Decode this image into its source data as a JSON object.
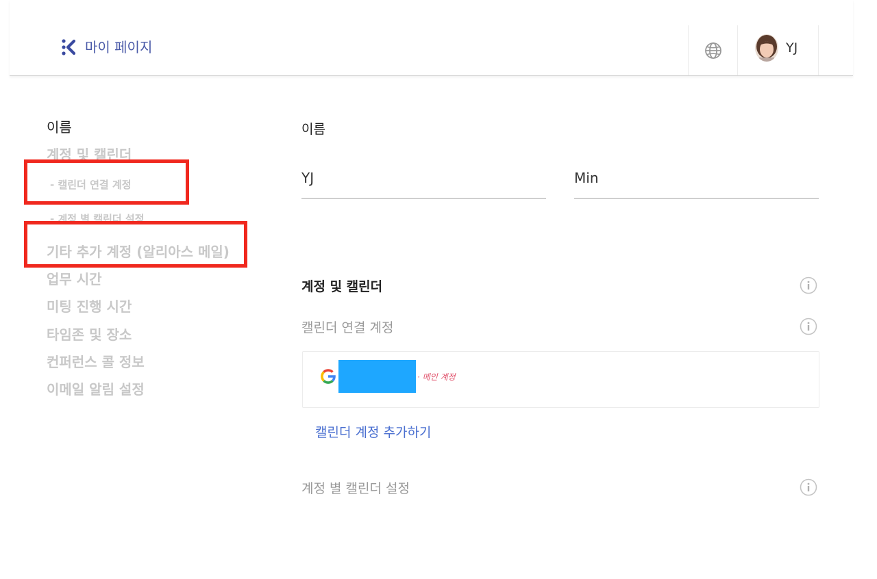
{
  "header": {
    "title": "마이 페이지",
    "user_initials": "YJ",
    "logo_icon": "logo-mark-icon",
    "language_icon": "globe-icon"
  },
  "sidebar": {
    "items": [
      {
        "label": "이름",
        "active": true
      },
      {
        "label": "계정 및 캘린더"
      },
      {
        "label": "- 캘린더 연결 계정",
        "sub": true
      },
      {
        "label": "- 계정 별 캘린더 설정",
        "sub": true
      },
      {
        "label": "기타 추가 계정 (알리아스 메일)"
      },
      {
        "label": "업무 시간"
      },
      {
        "label": "미팅 진행 시간"
      },
      {
        "label": "타임존 및 장소"
      },
      {
        "label": "컨퍼런스 콜 정보"
      },
      {
        "label": "이메일 알림 설정"
      }
    ]
  },
  "main": {
    "name_section": {
      "title": "이름",
      "first_name": "YJ",
      "last_name": "Min"
    },
    "accounts_section": {
      "title": "계정 및 캘린더",
      "connected_label": "캘린더 연결 계정",
      "account": {
        "provider_icon": "google-icon",
        "main_tag": "· 메인 계정"
      },
      "add_link": "캘린더 계정 추가하기",
      "per_account_label": "계정 별 캘린더 설정"
    }
  },
  "colors": {
    "accent": "#4a5aa8",
    "link": "#4a6fd0",
    "highlight": "#f0281e",
    "redacted": "#1ea7ff",
    "main_tag": "#e0506a"
  }
}
